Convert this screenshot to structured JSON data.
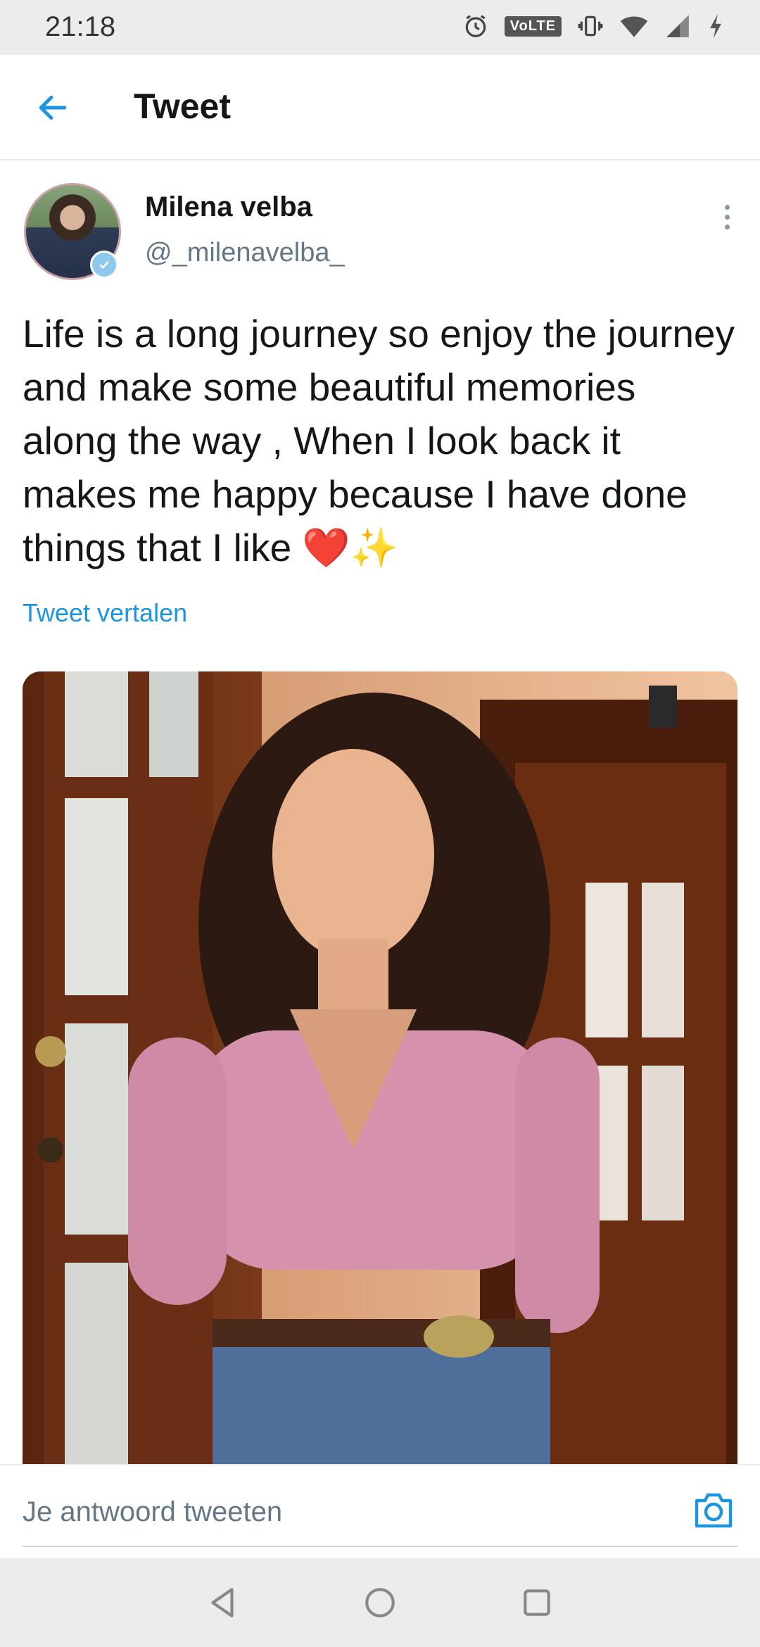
{
  "status_bar": {
    "time": "21:18",
    "volte": "VoLTE",
    "icons": [
      "alarm-icon",
      "vibrate-icon",
      "wifi-icon",
      "signal-icon",
      "charging-icon"
    ]
  },
  "header": {
    "back_icon": "back-arrow-icon",
    "title": "Tweet"
  },
  "tweet": {
    "display_name": "Milena velba",
    "handle": "@_milenavelba_",
    "text": "Life is a long journey so enjoy the journey and make some beautiful memories along the way , When I look back it makes me happy because I have done things that I like ❤️✨",
    "translate_label": "Tweet vertalen",
    "verified": true
  },
  "reply": {
    "placeholder": "Je antwoord tweeten",
    "camera_icon": "camera-icon"
  },
  "nav": {
    "icons": [
      "back-triangle-icon",
      "home-circle-icon",
      "recents-square-icon"
    ]
  },
  "colors": {
    "accent": "#1b95e0",
    "text": "#14171a",
    "secondary": "#657786"
  }
}
